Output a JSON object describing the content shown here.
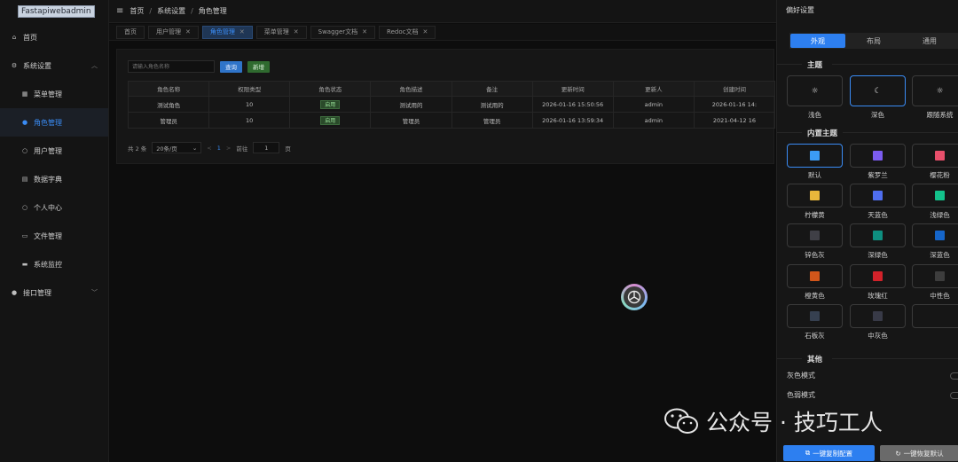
{
  "app": {
    "logo_text": "Fastapiwebadmin"
  },
  "sidebar": {
    "items": [
      {
        "label": "首页"
      },
      {
        "label": "系统设置"
      },
      {
        "label": "菜单管理"
      },
      {
        "label": "角色管理"
      },
      {
        "label": "用户管理"
      },
      {
        "label": "数据字典"
      },
      {
        "label": "个人中心"
      },
      {
        "label": "文件管理"
      },
      {
        "label": "系统监控"
      },
      {
        "label": "接口管理"
      }
    ]
  },
  "breadcrumb": [
    "首页",
    "系统设置",
    "角色管理"
  ],
  "tabs": [
    {
      "label": "首页"
    },
    {
      "label": "用户管理"
    },
    {
      "label": "角色管理"
    },
    {
      "label": "菜单管理"
    },
    {
      "label": "Swagger文档"
    },
    {
      "label": "Redoc文档"
    }
  ],
  "search": {
    "placeholder": "请输入角色名称",
    "query_label": "查询",
    "add_label": "新增"
  },
  "table": {
    "headers": [
      "角色名称",
      "权限类型",
      "角色状态",
      "角色描述",
      "备注",
      "更新时间",
      "更新人",
      "创建时间"
    ],
    "rows": [
      [
        "测试角色",
        "10",
        "启用",
        "测试用的",
        "测试用的",
        "2026-01-16 15:50:56",
        "admin",
        "2026-01-16 14:"
      ],
      [
        "管理员",
        "10",
        "启用",
        "管理员",
        "管理员",
        "2026-01-16 13:59:34",
        "admin",
        "2021-04-12 16"
      ]
    ]
  },
  "pager": {
    "total": "共 2 条",
    "page_size": "20条/页",
    "prev": "<",
    "page": "1",
    "next": ">",
    "goto": "前往",
    "goto_value": "1",
    "unit": "页"
  },
  "drawer": {
    "title": "偏好设置",
    "segments": [
      "外观",
      "布局",
      "通用"
    ],
    "theme_title": "主题",
    "themes": [
      {
        "label": "浅色",
        "icon": "sun-icon"
      },
      {
        "label": "深色",
        "icon": "moon-icon"
      },
      {
        "label": "跟随系统",
        "icon": "sun-icon"
      }
    ],
    "builtin_title": "内置主题",
    "colors": [
      {
        "label": "默认",
        "color": "#3b9cf4"
      },
      {
        "label": "紫罗兰",
        "color": "#7b5cf0"
      },
      {
        "label": "樱花粉",
        "color": "#e84f6b"
      },
      {
        "label": "柠檬黄",
        "color": "#e8b73b"
      },
      {
        "label": "天蓝色",
        "color": "#4f6ef0"
      },
      {
        "label": "浅绿色",
        "color": "#13c28b"
      },
      {
        "label": "锌色灰",
        "color": "#3f3f46"
      },
      {
        "label": "深绿色",
        "color": "#0e8f80"
      },
      {
        "label": "深蓝色",
        "color": "#1565c9"
      },
      {
        "label": "橙黄色",
        "color": "#d2561a"
      },
      {
        "label": "玫瑰红",
        "color": "#d2222a"
      },
      {
        "label": "中性色",
        "color": "#3d3d3d"
      },
      {
        "label": "石板灰",
        "color": "#364050"
      },
      {
        "label": "中灰色",
        "color": "#383a47"
      },
      {
        "label": "",
        "color": ""
      }
    ],
    "other_title": "其他",
    "gray_mode": "灰色模式",
    "color_weak": "色弱模式",
    "copy_btn": "一键复制配置",
    "reset_btn": "一键恢复默认"
  },
  "watermark": {
    "text": "公众号 · 技巧工人"
  }
}
